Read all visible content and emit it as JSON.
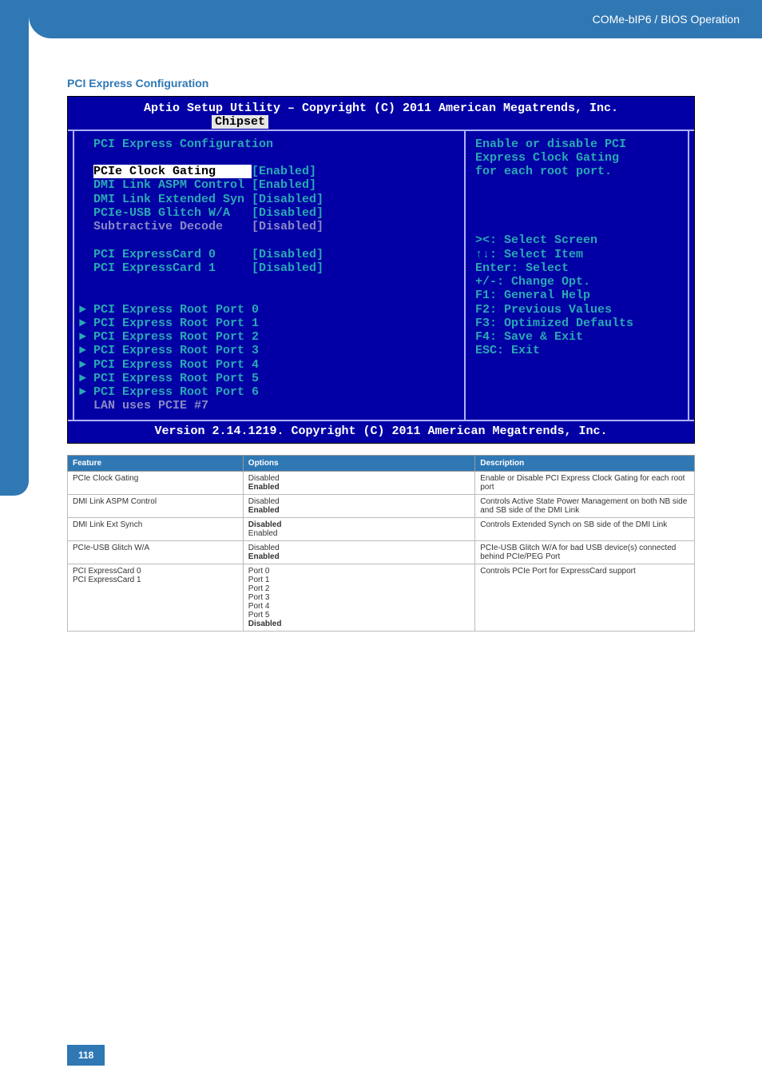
{
  "header": {
    "breadcrumb": "COMe-bIP6 / BIOS Operation"
  },
  "section_title": "PCI Express Configuration",
  "bios": {
    "title": "Aptio Setup Utility – Copyright (C) 2011 American Megatrends, Inc.",
    "active_tab": "Chipset",
    "page_heading": "PCI Express Configuration",
    "settings": [
      {
        "label": "PCIe Clock Gating",
        "value": "[Enabled]",
        "highlight": true
      },
      {
        "label": "DMI Link ASPM Control",
        "value": "[Enabled]"
      },
      {
        "label": "DMI Link Extended Syn",
        "value": "[Disabled]"
      },
      {
        "label": "PCIe-USB Glitch W/A",
        "value": "[Disabled]"
      },
      {
        "label": "Subtractive Decode",
        "value": "[Disabled]",
        "gray": true
      }
    ],
    "cards": [
      {
        "label": "PCI ExpressCard 0",
        "value": "[Disabled]"
      },
      {
        "label": "PCI ExpressCard 1",
        "value": "[Disabled]"
      }
    ],
    "root_ports": [
      "PCI Express Root Port 0",
      "PCI Express Root Port 1",
      "PCI Express Root Port 2",
      "PCI Express Root Port 3",
      "PCI Express Root Port 4",
      "PCI Express Root Port 5",
      "PCI Express Root Port 6"
    ],
    "root_note": "LAN uses PCIE #7",
    "help_text": "Enable or disable PCI\nExpress Clock Gating\nfor each root port.",
    "nav_help": "><: Select Screen\n↑↓: Select Item\nEnter: Select\n+/-: Change Opt.\nF1: General Help\nF2: Previous Values\nF3: Optimized Defaults\nF4: Save & Exit\nESC: Exit",
    "footer": "Version 2.14.1219. Copyright (C) 2011 American Megatrends, Inc."
  },
  "table": {
    "headers": {
      "c1": "Feature",
      "c2": "Options",
      "c3": "Description"
    },
    "rows": [
      {
        "feature": "PCIe Clock Gating",
        "options": [
          {
            "t": "Disabled",
            "b": false
          },
          {
            "t": "Enabled",
            "b": true
          }
        ],
        "desc": "Enable or Disable PCI Express Clock Gating for each root port"
      },
      {
        "feature": "DMI Link ASPM Control",
        "options": [
          {
            "t": "Disabled",
            "b": false
          },
          {
            "t": "Enabled",
            "b": true
          }
        ],
        "desc": "Controls Active State Power Management on both NB side and SB side of the DMI Link"
      },
      {
        "feature": "DMI Link Ext Synch",
        "options": [
          {
            "t": "Disabled",
            "b": true
          },
          {
            "t": "Enabled",
            "b": false
          }
        ],
        "desc": "Controls Extended Synch on SB side of the DMI Link"
      },
      {
        "feature": "PCIe-USB Glitch W/A",
        "options": [
          {
            "t": "Disabled",
            "b": false
          },
          {
            "t": "Enabled",
            "b": true
          }
        ],
        "desc": "PCIe-USB Glitch W/A for bad USB device(s) connected behind PCIe/PEG Port"
      },
      {
        "feature": "PCI ExpressCard 0\nPCI ExpressCard 1",
        "options": [
          {
            "t": "Port 0",
            "b": false
          },
          {
            "t": "Port 1",
            "b": false
          },
          {
            "t": "Port 2",
            "b": false
          },
          {
            "t": "Port 3",
            "b": false
          },
          {
            "t": "Port 4",
            "b": false
          },
          {
            "t": "Port 5",
            "b": false
          },
          {
            "t": "Disabled",
            "b": true
          }
        ],
        "desc": "Controls PCIe Port for ExpressCard support"
      }
    ]
  },
  "page_number": "118"
}
